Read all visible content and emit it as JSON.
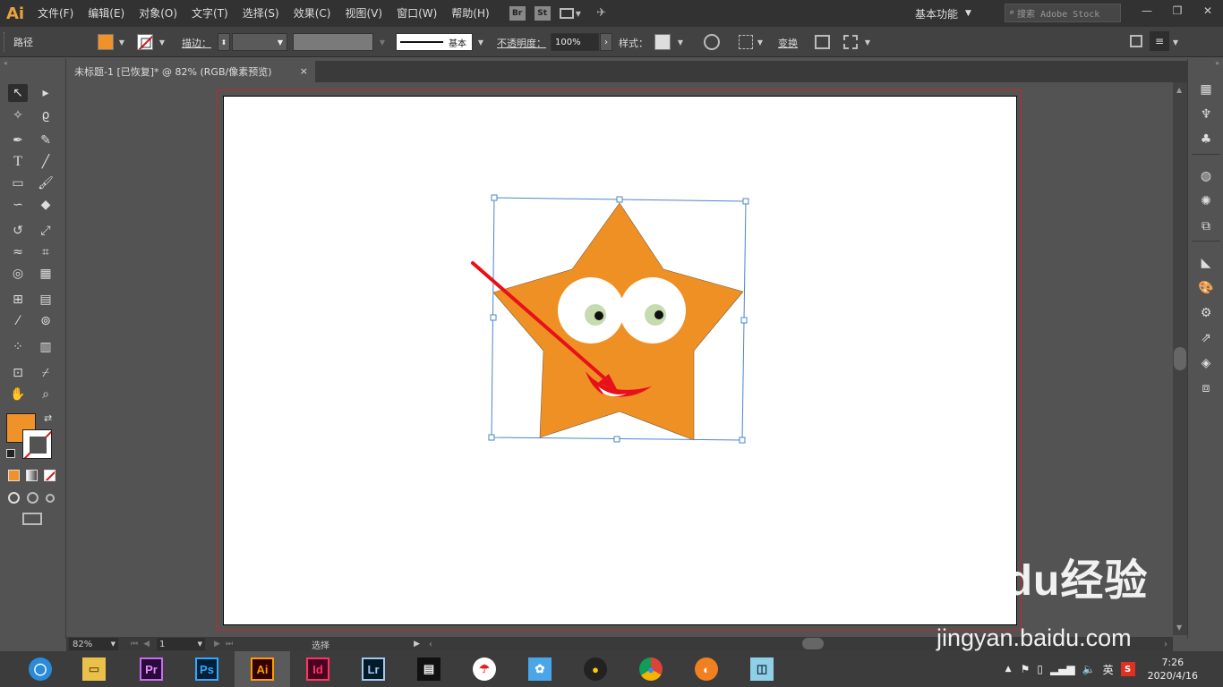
{
  "app": {
    "logo": "Ai"
  },
  "menu": [
    "文件(F)",
    "编辑(E)",
    "对象(O)",
    "文字(T)",
    "选择(S)",
    "效果(C)",
    "视图(V)",
    "窗口(W)",
    "帮助(H)"
  ],
  "menubar_icons": {
    "bridge": "Br",
    "stock": "St"
  },
  "workspace": {
    "label": "基本功能"
  },
  "search": {
    "placeholder": "搜索 Adobe Stock"
  },
  "control": {
    "path_label": "路径",
    "fill_color": "#f0922a",
    "stroke_label": "描边：",
    "stroke_style": "基本",
    "opacity_label": "不透明度：",
    "opacity_value": "100%",
    "style_label": "样式：",
    "transform_label": "变换"
  },
  "document": {
    "tab_title": "未标题-1 [已恢复]* @ 82% (RGB/像素预览)",
    "close": "×"
  },
  "colors": {
    "fill": "#f0922a",
    "star": "#ef9024",
    "selection": "#4a86c8",
    "arrow": "#e8101a",
    "bleed": "#c0282d"
  },
  "status": {
    "zoom": "82%",
    "page": "1",
    "tool": "选择"
  },
  "taskbar": {
    "apps": [
      {
        "name": "browser",
        "label": ""
      },
      {
        "name": "explorer",
        "label": ""
      },
      {
        "name": "premiere",
        "label": "Pr"
      },
      {
        "name": "photoshop",
        "label": "Ps"
      },
      {
        "name": "illustrator",
        "label": "Ai"
      },
      {
        "name": "indesign",
        "label": "Id"
      },
      {
        "name": "lightroom",
        "label": "Lr"
      },
      {
        "name": "video",
        "label": ""
      },
      {
        "name": "umbrella",
        "label": ""
      },
      {
        "name": "bird",
        "label": ""
      },
      {
        "name": "qq",
        "label": ""
      },
      {
        "name": "chrome",
        "label": ""
      },
      {
        "name": "cloud",
        "label": ""
      },
      {
        "name": "notes",
        "label": ""
      }
    ],
    "ime": "英",
    "time": "7:26",
    "date": "2020/4/16"
  },
  "watermark": {
    "brand": "Baidu经验",
    "url": "jingyan.baidu.com"
  }
}
